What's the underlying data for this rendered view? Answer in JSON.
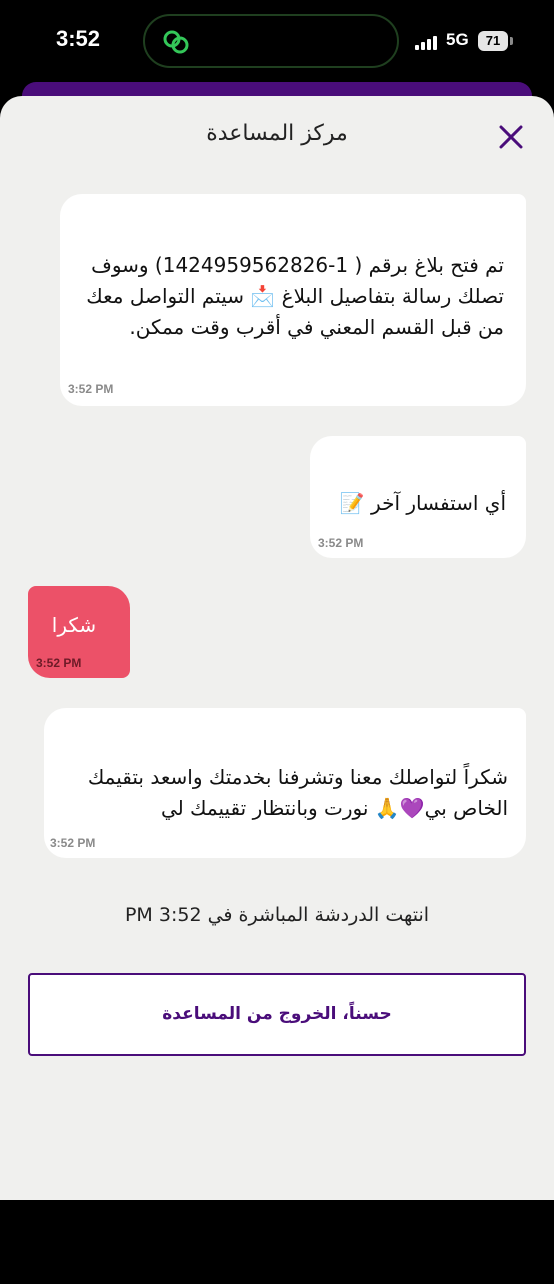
{
  "status_bar": {
    "time": "3:52",
    "network": "5G",
    "battery": "71"
  },
  "header": {
    "title": "مركز المساعدة"
  },
  "messages": [
    {
      "text": "تم فتح بلاغ برقم ( 1-1424959562826) وسوف تصلك رسالة بتفاصيل البلاغ 📩 سيتم التواصل معك من قبل القسم المعني في أقرب وقت ممكن.",
      "time": "3:52 PM"
    },
    {
      "text": "أي استفسار آخر 📝",
      "time": "3:52 PM"
    },
    {
      "text": "شكرا",
      "time": "3:52 PM"
    },
    {
      "text": "شكراً لتواصلك معنا وتشرفنا بخدمتك واسعد بتقيمك الخاص بي💜🙏 نورت وبانتظار تقييمك لي",
      "time": "3:52 PM"
    }
  ],
  "chat_end_note": "انتهت الدردشة المباشرة في 3:52 PM",
  "exit_button": {
    "label": "حسناً، الخروج من المساعدة"
  },
  "colors": {
    "accent": "#4a0d7a",
    "user_bubble": "#ec5168",
    "background": "#f0f0ee"
  },
  "icons": {
    "close": "close-icon",
    "app": "app-logo-icon"
  }
}
